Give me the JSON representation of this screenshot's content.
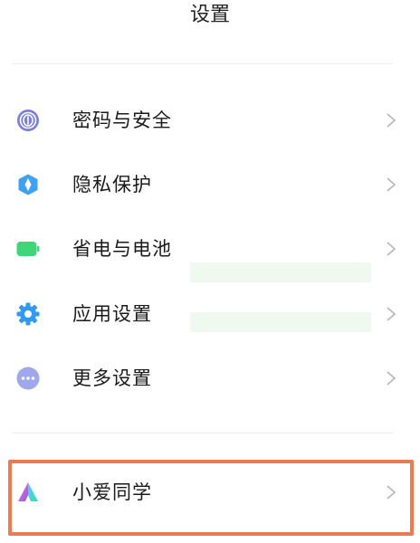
{
  "header": {
    "title": "设置"
  },
  "items": [
    {
      "id": "password-security",
      "label": "密码与安全",
      "icon": "fingerprint-icon",
      "color": "#7a7fd9"
    },
    {
      "id": "privacy",
      "label": "隐私保护",
      "icon": "privacy-shield-icon",
      "color": "#3ea1f2"
    },
    {
      "id": "battery",
      "label": "省电与电池",
      "icon": "battery-icon",
      "color": "#3fd67a"
    },
    {
      "id": "app-settings",
      "label": "应用设置",
      "icon": "gear-icon",
      "color": "#2f9af0"
    },
    {
      "id": "more-settings",
      "label": "更多设置",
      "icon": "more-dots-icon",
      "color": "#9fa8ea"
    },
    {
      "id": "xiaoai",
      "label": "小爱同学",
      "icon": "xiaoai-icon",
      "highlighted": true,
      "highlight_color": "#ea7b52"
    }
  ]
}
